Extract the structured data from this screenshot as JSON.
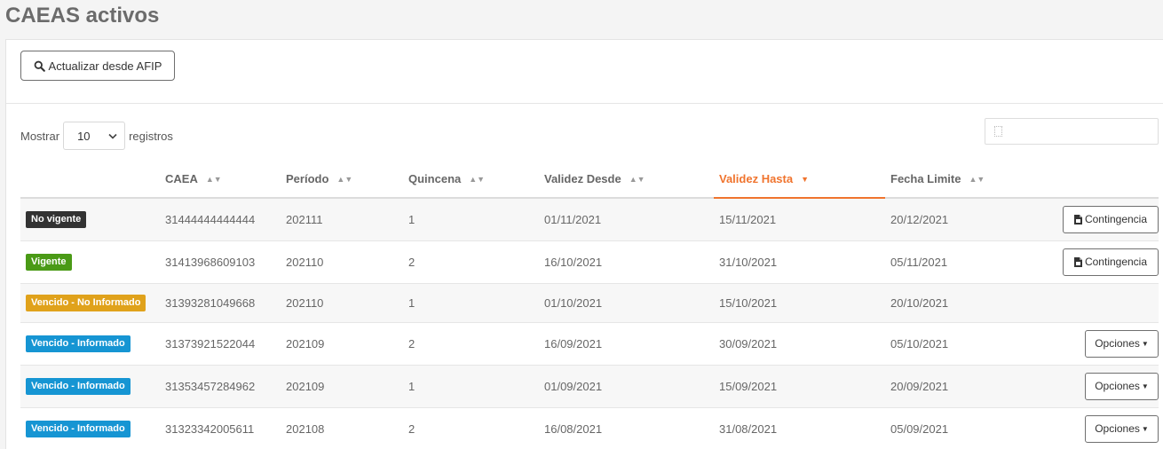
{
  "page": {
    "title": "CAEAS activos"
  },
  "toolbar": {
    "refresh_label": "Actualizar desde AFIP",
    "refresh_icon": "search-icon"
  },
  "length_menu": {
    "prefix": "Mostrar",
    "value": "10",
    "suffix": "registros"
  },
  "search": {
    "placeholder": "",
    "value": ""
  },
  "table": {
    "sorted_column": "Validez Hasta",
    "headers": [
      "",
      "CAEA",
      "Período",
      "Quincena",
      "Validez Desde",
      "Validez Hasta",
      "Fecha Limite",
      ""
    ],
    "rows": [
      {
        "status": "No vigente",
        "status_color": "#333333",
        "caea": "31444444444444",
        "periodo": "202111",
        "quincena": "1",
        "desde": "01/11/2021",
        "hasta": "15/11/2021",
        "limite": "20/12/2021",
        "action": "Contingencia"
      },
      {
        "status": "Vigente",
        "status_color": "#4a9a16",
        "caea": "31413968609103",
        "periodo": "202110",
        "quincena": "2",
        "desde": "16/10/2021",
        "hasta": "31/10/2021",
        "limite": "05/11/2021",
        "action": "Contingencia"
      },
      {
        "status": "Vencido - No Informado",
        "status_color": "#e0a21b",
        "caea": "31393281049668",
        "periodo": "202110",
        "quincena": "1",
        "desde": "01/10/2021",
        "hasta": "15/10/2021",
        "limite": "20/10/2021",
        "action": ""
      },
      {
        "status": "Vencido - Informado",
        "status_color": "#1695d3",
        "caea": "31373921522044",
        "periodo": "202109",
        "quincena": "2",
        "desde": "16/09/2021",
        "hasta": "30/09/2021",
        "limite": "05/10/2021",
        "action": "Opciones"
      },
      {
        "status": "Vencido - Informado",
        "status_color": "#1695d3",
        "caea": "31353457284962",
        "periodo": "202109",
        "quincena": "1",
        "desde": "01/09/2021",
        "hasta": "15/09/2021",
        "limite": "20/09/2021",
        "action": "Opciones"
      },
      {
        "status": "Vencido - Informado",
        "status_color": "#1695d3",
        "caea": "31323342005611",
        "periodo": "202108",
        "quincena": "2",
        "desde": "16/08/2021",
        "hasta": "31/08/2021",
        "limite": "05/09/2021",
        "action": "Opciones"
      }
    ]
  },
  "colors": {
    "accent_sort": "#f0742e",
    "title": "#6b6b6b",
    "text": "#666666"
  }
}
